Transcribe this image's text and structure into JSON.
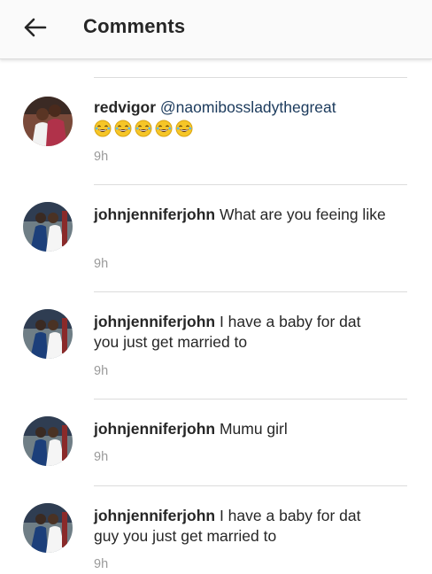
{
  "header": {
    "title": "Comments",
    "back_icon": "arrow-left-icon"
  },
  "comments": [
    {
      "username": "redvigor",
      "mention": "@naomibossladythegreat",
      "text": "",
      "emoji_count": 5,
      "emoji": "😂",
      "time": "9h",
      "avatar_icon": "couple-avatar"
    },
    {
      "username": "johnjenniferjohn",
      "mention": "",
      "text": "What are you feeing like",
      "emoji_count": 0,
      "time": "9h",
      "avatar_icon": "wedding-avatar"
    },
    {
      "username": "johnjenniferjohn",
      "mention": "",
      "text": "I have a baby for dat you just get married to",
      "emoji_count": 0,
      "time": "9h",
      "avatar_icon": "wedding-avatar"
    },
    {
      "username": "johnjenniferjohn",
      "mention": "",
      "text": "Mumu girl",
      "emoji_count": 0,
      "time": "9h",
      "avatar_icon": "wedding-avatar"
    },
    {
      "username": "johnjenniferjohn",
      "mention": "",
      "text": "I have a baby for dat guy you just get married to",
      "emoji_count": 0,
      "time": "9h",
      "avatar_icon": "wedding-avatar"
    }
  ]
}
